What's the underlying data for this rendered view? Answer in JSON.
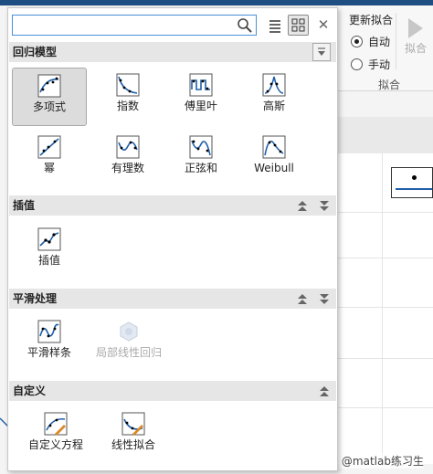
{
  "toolstrip": {
    "update_title": "更新拟合",
    "auto_label": "自动",
    "manual_label": "手动",
    "fit_button_label": "拟合",
    "group_label": "拟合"
  },
  "search": {
    "value": "",
    "placeholder": ""
  },
  "sections": {
    "regression": {
      "title": "回归模型",
      "items": [
        "多项式",
        "指数",
        "傅里叶",
        "高斯",
        "幂",
        "有理数",
        "正弦和",
        "Weibull"
      ]
    },
    "interpolation": {
      "title": "插值",
      "items": [
        "插值"
      ]
    },
    "smoothing": {
      "title": "平滑处理",
      "items": [
        "平滑样条",
        "局部线性回归"
      ]
    },
    "custom": {
      "title": "自定义",
      "items": [
        "自定义方程",
        "线性拟合"
      ]
    }
  },
  "watermark": "CSDN @matlab练习生",
  "colors": {
    "accent": "#1f4f82",
    "search_border": "#4a90d9",
    "icon_blue": "#1f5faa"
  }
}
